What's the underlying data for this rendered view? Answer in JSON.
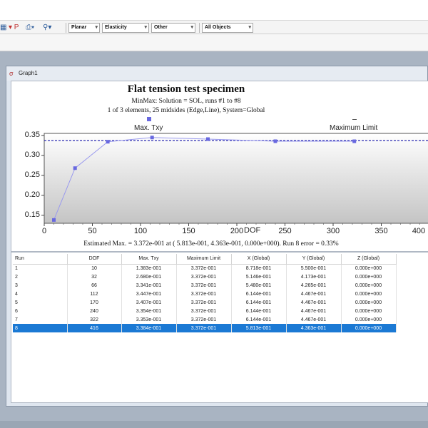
{
  "toolbar": {
    "combos": [
      "Planar",
      "Elasticity",
      "Other",
      "All Objects"
    ]
  },
  "window": {
    "title": "Graph1"
  },
  "graph": {
    "title": "Flat tension test specimen",
    "subtitle1": "MinMax: Solution = SOL, runs #1 to #8",
    "subtitle2": "1 of 3 elements, 25 midsides (Edge,Line), System=Global",
    "legend_series": "Max. Txy",
    "legend_limit": "Maximum Limit",
    "xlabel": "DOF",
    "estimate": "Estimated Max. = 3.372e-001 at ( 5.813e-001, 4.363e-001, 0.000e+000). Run 8 error = 0.33%"
  },
  "chart_data": {
    "type": "line",
    "xlabel": "DOF",
    "ylabel": "",
    "xlim": [
      0,
      400
    ],
    "ylim": [
      0.13,
      0.355
    ],
    "x_ticks": [
      0,
      50,
      100,
      150,
      200,
      250,
      300,
      350,
      400
    ],
    "y_ticks": [
      0.15,
      0.2,
      0.25,
      0.3,
      0.35
    ],
    "series": [
      {
        "name": "Max. Txy",
        "x": [
          10,
          32,
          66,
          112,
          170,
          240,
          322,
          416
        ],
        "y": [
          0.1383,
          0.268,
          0.3341,
          0.3447,
          0.3407,
          0.3354,
          0.3353,
          0.3384
        ]
      },
      {
        "name": "Maximum Limit",
        "y_constant": 0.3372
      }
    ],
    "series_color": "#6868e0",
    "limit_color": "#2b2bb0"
  },
  "table": {
    "headers": [
      "Run",
      "DOF",
      "Max. Txy",
      "Maximum Limit",
      "X (Global)",
      "Y (Global)",
      "Z (Global)"
    ],
    "rows": [
      [
        "1",
        "10",
        "1.383e-001",
        "3.372e-001",
        "8.718e-001",
        "5.500e-001",
        "0.000e+000"
      ],
      [
        "2",
        "32",
        "2.680e-001",
        "3.372e-001",
        "5.146e-001",
        "4.173e-001",
        "0.000e+000"
      ],
      [
        "3",
        "66",
        "3.341e-001",
        "3.372e-001",
        "5.480e-001",
        "4.265e-001",
        "0.000e+000"
      ],
      [
        "4",
        "112",
        "3.447e-001",
        "3.372e-001",
        "6.144e-001",
        "4.467e-001",
        "0.000e+000"
      ],
      [
        "5",
        "170",
        "3.407e-001",
        "3.372e-001",
        "6.144e-001",
        "4.467e-001",
        "0.000e+000"
      ],
      [
        "6",
        "240",
        "3.354e-001",
        "3.372e-001",
        "6.144e-001",
        "4.467e-001",
        "0.000e+000"
      ],
      [
        "7",
        "322",
        "3.353e-001",
        "3.372e-001",
        "6.144e-001",
        "4.467e-001",
        "0.000e+000"
      ],
      [
        "8",
        "416",
        "3.384e-001",
        "3.372e-001",
        "5.813e-001",
        "4.363e-001",
        "0.000e+000"
      ]
    ],
    "selected_row": 7
  }
}
